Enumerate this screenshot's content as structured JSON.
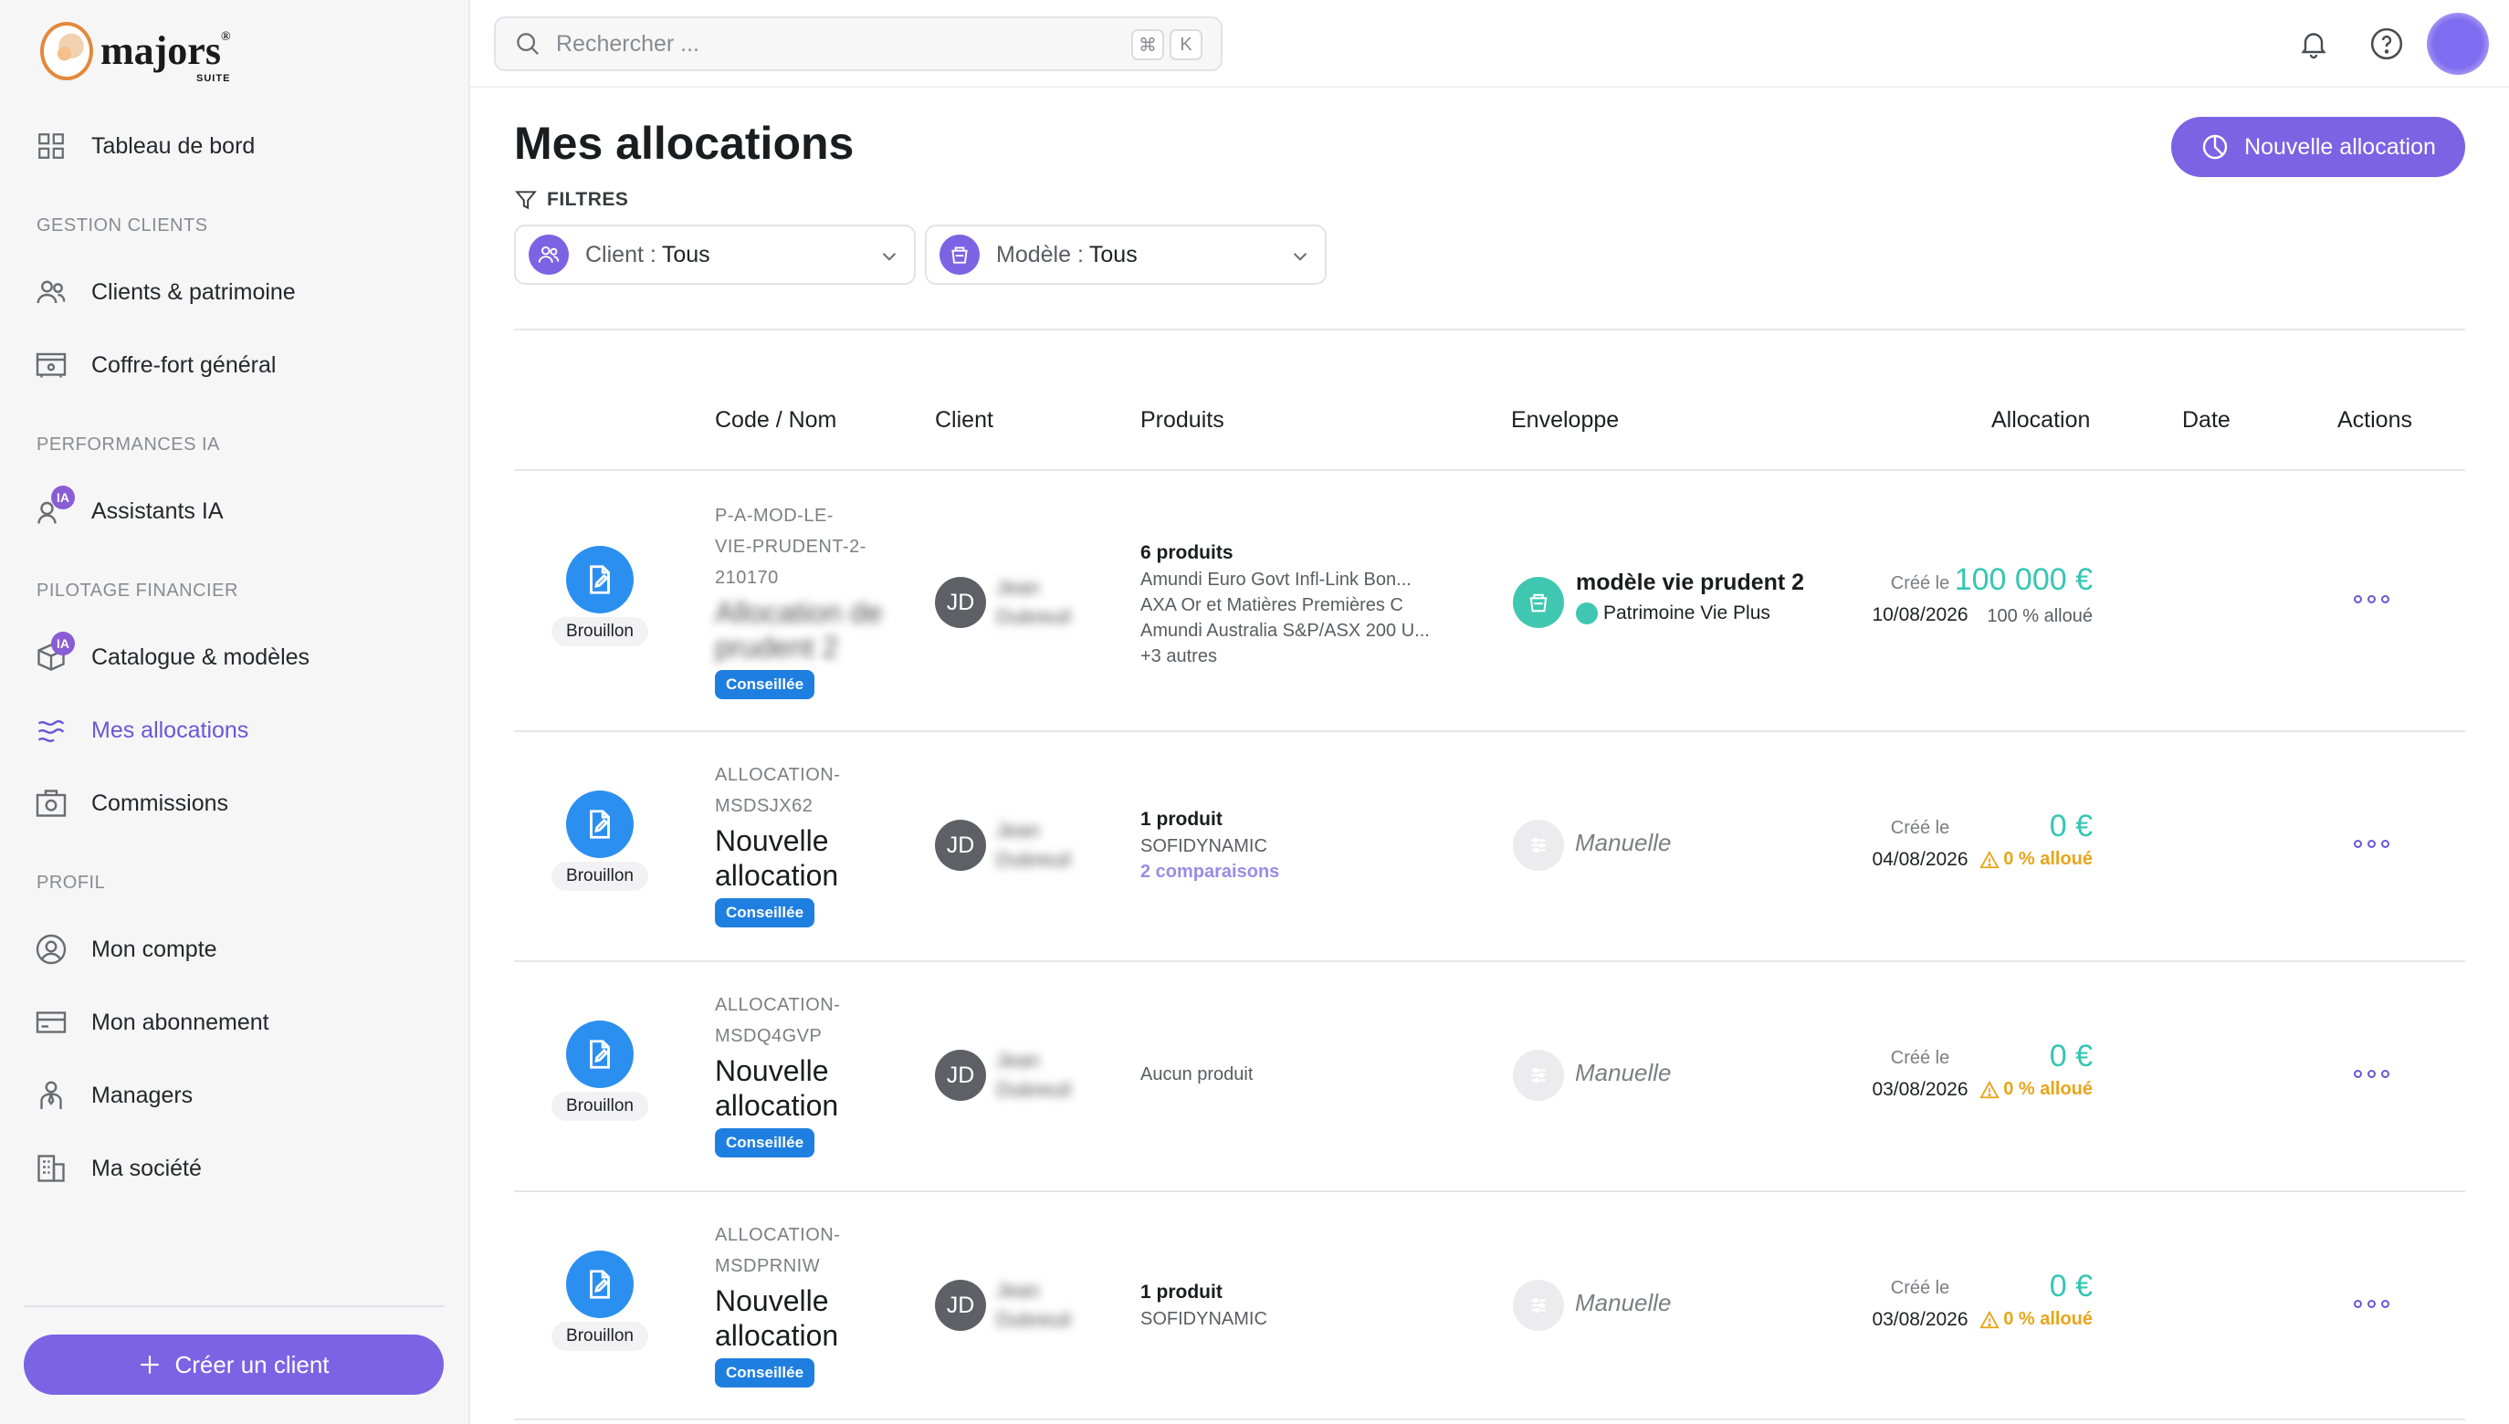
{
  "brand": {
    "name": "majors",
    "sub": "SUITE",
    "reg": "®"
  },
  "sidebar": {
    "dashboard": "Tableau de bord",
    "sections": {
      "clients": "GESTION CLIENTS",
      "perf": "PERFORMANCES IA",
      "pilotage": "PILOTAGE FINANCIER",
      "profil": "PROFIL"
    },
    "items": {
      "clients": "Clients & patrimoine",
      "vault": "Coffre-fort général",
      "assistants": "Assistants IA",
      "catalogue": "Catalogue & modèles",
      "allocations": "Mes allocations",
      "commissions": "Commissions",
      "account": "Mon compte",
      "subscription": "Mon abonnement",
      "managers": "Managers",
      "company": "Ma société"
    },
    "ia_badge": "IA",
    "create_button": "Créer un client"
  },
  "search": {
    "placeholder": "Rechercher ...",
    "key1": "⌘",
    "key2": "K"
  },
  "page": {
    "title": "Mes allocations",
    "new_button": "Nouvelle allocation",
    "filters_label": "FILTRES",
    "filter_client": {
      "label": "Client :",
      "value": "Tous"
    },
    "filter_model": {
      "label": "Modèle :",
      "value": "Tous"
    }
  },
  "table": {
    "headers": [
      "Code / Nom",
      "Client",
      "Produits",
      "Enveloppe",
      "Allocation",
      "Date",
      "Actions"
    ],
    "rows": [
      {
        "status": "Brouillon",
        "code": [
          "P-A-MOD-LE-",
          "VIE-PRUDENT-2-",
          "210170"
        ],
        "name": [
          "Allocation de",
          "prudent 2"
        ],
        "badge": "Conseillée",
        "client_initials": "JD",
        "client_name": [
          "Jean",
          "Dubreuil"
        ],
        "products_count": "6 produits",
        "products": [
          "Amundi Euro Govt Infl-Link Bon...",
          "AXA Or et Matières Premières C",
          "Amundi Australia S&P/ASX 200 U...",
          "+3 autres"
        ],
        "envelope_name": "modèle vie prudent 2",
        "envelope_sub": "Patrimoine Vie Plus",
        "amount": "100 000 €",
        "alloc_pct": "100 % alloué",
        "date_label": "Créé le",
        "date": "10/08/2026"
      },
      {
        "status": "Brouillon",
        "code": [
          "ALLOCATION-",
          "MSDSJX62"
        ],
        "name": [
          "Nouvelle",
          "allocation"
        ],
        "badge": "Conseillée",
        "client_initials": "JD",
        "client_name": [
          "Jean",
          "Dubreuil"
        ],
        "products_count": "1 produit",
        "products": [
          "SOFIDYNAMIC"
        ],
        "products_link": "2 comparaisons",
        "envelope_manual": "Manuelle",
        "amount": "0 €",
        "alloc_pct": "0 % alloué",
        "date_label": "Créé le",
        "date": "04/08/2026"
      },
      {
        "status": "Brouillon",
        "code": [
          "ALLOCATION-",
          "MSDQ4GVP"
        ],
        "name": [
          "Nouvelle",
          "allocation"
        ],
        "badge": "Conseillée",
        "client_initials": "JD",
        "client_name": [
          "Jean",
          "Dubreuil"
        ],
        "products_none": "Aucun produit",
        "envelope_manual": "Manuelle",
        "amount": "0 €",
        "alloc_pct": "0 % alloué",
        "date_label": "Créé le",
        "date": "03/08/2026"
      },
      {
        "status": "Brouillon",
        "code": [
          "ALLOCATION-",
          "MSDPRNIW"
        ],
        "name": [
          "Nouvelle",
          "allocation"
        ],
        "badge": "Conseillée",
        "client_initials": "JD",
        "client_name": [
          "Jean",
          "Dubreuil"
        ],
        "products_count": "1 produit",
        "products": [
          "SOFIDYNAMIC"
        ],
        "envelope_manual": "Manuelle",
        "amount": "0 €",
        "alloc_pct": "0 % alloué",
        "date_label": "Créé le",
        "date": "03/08/2026"
      }
    ]
  },
  "colors": {
    "accent": "#7b63e3",
    "teal": "#35c6b3",
    "warning": "#e8a51b",
    "status_blue": "#2b8ff0"
  }
}
